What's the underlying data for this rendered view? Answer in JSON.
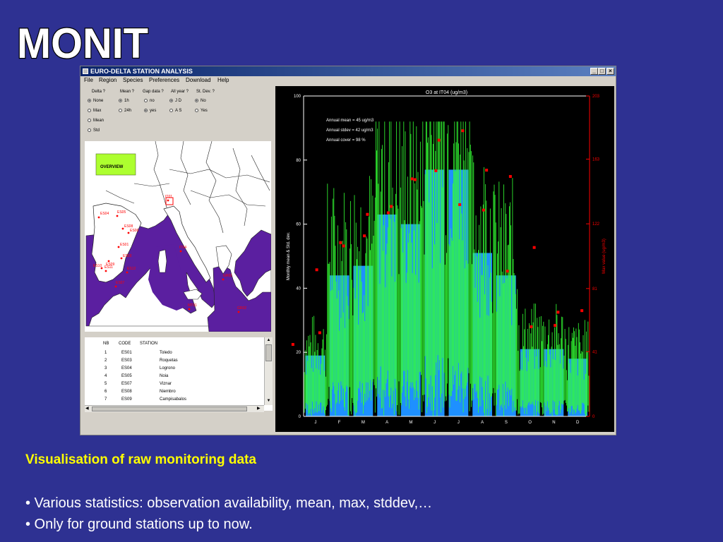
{
  "slide": {
    "title": "MONIT",
    "caption_heading": "Visualisation of raw monitoring data",
    "bullets": [
      "• Various statistics: observation availability, mean, max, stddev,…",
      "• Only for ground stations up to now."
    ]
  },
  "window": {
    "title": "EURO-DELTA STATION ANALYSIS",
    "menu": [
      "File",
      "Region",
      "Species",
      "Preferences",
      "Download",
      "Help"
    ]
  },
  "options": {
    "groups": [
      {
        "header": "Delta ?",
        "items": [
          "None",
          "Max",
          "Mean",
          "Std"
        ],
        "selected": 0
      },
      {
        "header": "Mean ?",
        "items": [
          "1h",
          "24h"
        ],
        "selected": 0
      },
      {
        "header": "Gap data ?",
        "items": [
          "no",
          "yes"
        ],
        "selected": 1
      },
      {
        "header": "All year ?",
        "items": [
          "J D",
          "A S"
        ],
        "selected": 0
      },
      {
        "header": "St. Dev. ?",
        "items": [
          "No",
          "Yes"
        ],
        "selected": 0
      }
    ]
  },
  "map": {
    "overview_label": "OVERVIEW",
    "stations": [
      "ES01",
      "ES03",
      "ES04",
      "ES05",
      "ES06",
      "ES07",
      "ES08",
      "ES09",
      "ES10",
      "ES11",
      "ES12",
      "ES13",
      "ES14",
      "ES15",
      "IT01",
      "IT04",
      "IT05",
      "GR01",
      "GR02",
      "MT01"
    ],
    "land_color": "#ffffff",
    "sea_color": "#5b1fa0",
    "station_color": "#ff0000"
  },
  "table": {
    "headers": [
      "NB",
      "CODE",
      "STATION"
    ],
    "rows": [
      [
        "1",
        "ES01",
        "Toledo"
      ],
      [
        "2",
        "ES03",
        "Roquetas"
      ],
      [
        "3",
        "ES04",
        "Logrono"
      ],
      [
        "4",
        "ES05",
        "Noia"
      ],
      [
        "5",
        "ES07",
        "Viznar"
      ],
      [
        "6",
        "ES08",
        "Niembro"
      ],
      [
        "7",
        "ES09",
        "Campisabalos"
      ]
    ]
  },
  "chart_data": {
    "type": "bar",
    "title": "O3 at IT04   (ug/m3)",
    "ylabel": "Monthly mean & Std. dev.",
    "y2label": "Max value (ug/m3)",
    "categories": [
      "J",
      "F",
      "M",
      "A",
      "M",
      "J",
      "J",
      "A",
      "S",
      "O",
      "N",
      "D"
    ],
    "values": [
      19,
      44,
      47,
      63,
      60,
      77,
      77,
      51,
      44,
      21,
      21,
      18
    ],
    "max_values": [
      53,
      108,
      128,
      133,
      150,
      175,
      181,
      156,
      152,
      107,
      66,
      67
    ],
    "ylim": [
      0,
      100
    ],
    "y2lim": [
      0,
      203
    ],
    "yticks": [
      0,
      20,
      40,
      60,
      80,
      100
    ],
    "y2ticks": [
      0,
      41,
      81,
      122,
      163,
      203
    ],
    "annotations": [
      "Annual mean  = 45 ug/m3",
      "Annual stdev  = 42 ug/m3",
      "Annual cover  = 98 %"
    ],
    "colors": {
      "bars": "#1e90ff",
      "hourly": "#33ff33",
      "max": "#ff0000",
      "axes": "#ffffff",
      "axis2": "#ff0000"
    }
  }
}
